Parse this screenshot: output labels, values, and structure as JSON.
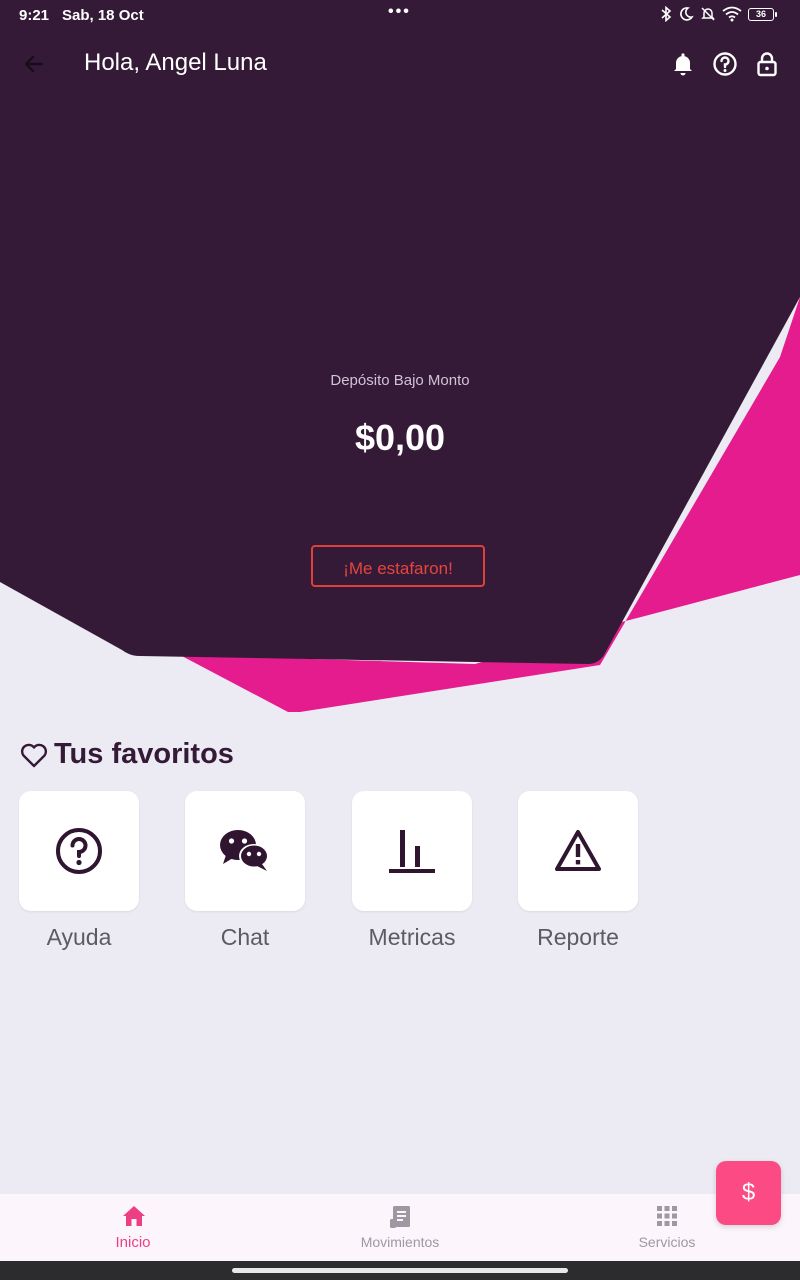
{
  "status_bar": {
    "time": "9:21",
    "date": "Sab, 18 Oct",
    "battery": "36"
  },
  "app_bar": {
    "greeting": "Hola, Angel Luna"
  },
  "balance": {
    "label": "Depósito Bajo Monto",
    "amount": "$0,00"
  },
  "fraud_button": "¡Me estafaron!",
  "favorites": {
    "title": "Tus favoritos",
    "items": [
      {
        "label": "Ayuda",
        "icon": "help-icon"
      },
      {
        "label": "Chat",
        "icon": "wechat-icon"
      },
      {
        "label": "Metricas",
        "icon": "bar-chart-icon"
      },
      {
        "label": "Reporte",
        "icon": "warning-icon"
      }
    ]
  },
  "bottom_nav": {
    "items": [
      {
        "label": "Inicio",
        "icon": "home-icon",
        "active": true
      },
      {
        "label": "Movimientos",
        "icon": "receipt-icon",
        "active": false
      },
      {
        "label": "Servicios",
        "icon": "apps-grid-icon",
        "active": false
      }
    ]
  },
  "fab": {
    "label": "$"
  },
  "colors": {
    "header": "#351a37",
    "accent_pink": "#e41c8d",
    "background": "#ecebf3",
    "fraud_red": "#e0403a",
    "fab": "#fc4a84"
  }
}
